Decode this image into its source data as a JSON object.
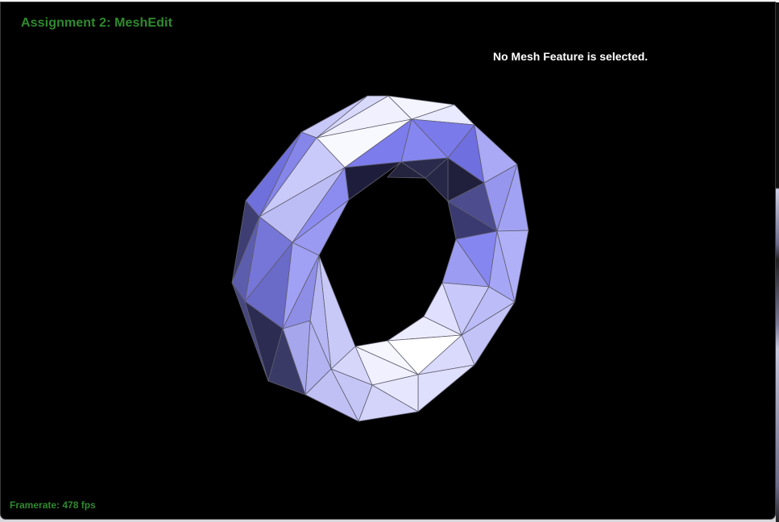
{
  "app": {
    "title": "Assignment 2: MeshEdit",
    "status": "No Mesh Feature is selected.",
    "framerate": "Framerate: 478 fps"
  },
  "colors": {
    "background": "#000000",
    "overlay_text": "#2e8b2e",
    "status_text": "#ffffff",
    "mesh_light": "#eeeeff",
    "mesh_mid": "#8e8ef0",
    "mesh_dark": "#252545"
  }
}
